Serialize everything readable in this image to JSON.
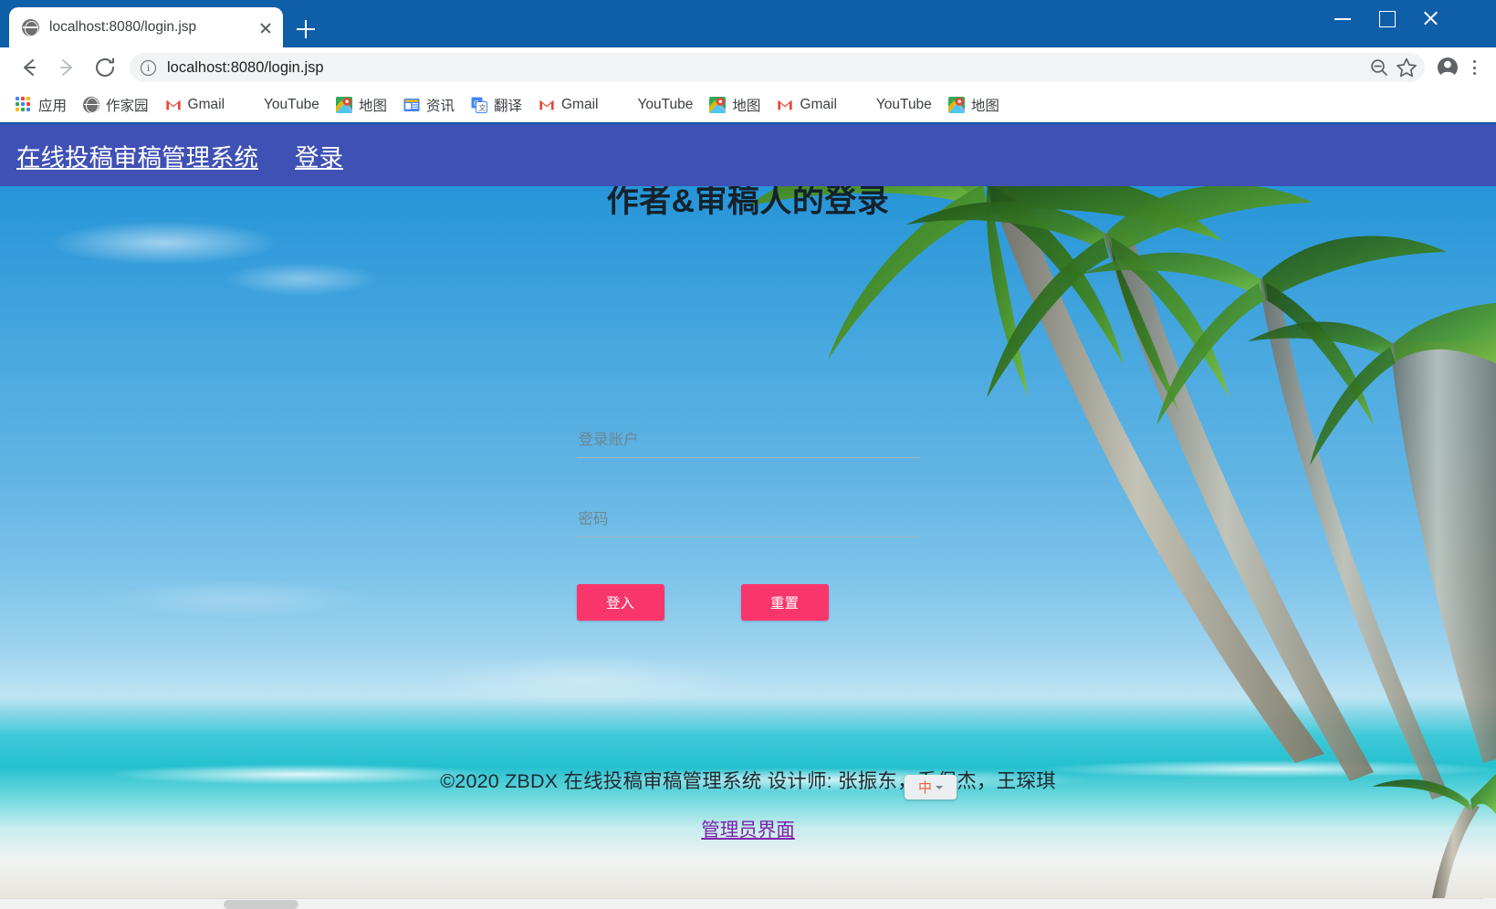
{
  "browser": {
    "tab": {
      "title": "localhost:8080/login.jsp",
      "favicon": "globe-icon",
      "close": "close-icon"
    },
    "newtab_label": "+",
    "window_controls": {
      "minimize": "minimize-icon",
      "maximize": "maximize-icon",
      "close": "close-icon"
    },
    "toolbar": {
      "back": "back-arrow-icon",
      "forward": "forward-arrow-icon",
      "reload": "reload-icon",
      "site_info": "i",
      "url": "localhost:8080/login.jsp",
      "zoom_out": "zoom-out-icon",
      "bookmark": "star-icon",
      "profile": "account-circle-icon",
      "menu": "three-dot-menu-icon"
    },
    "bookmarks": [
      {
        "label": "应用",
        "icon": "apps-grid-icon"
      },
      {
        "label": "作家园",
        "icon": "globe-icon"
      },
      {
        "label": "Gmail",
        "icon": "gmail-icon"
      },
      {
        "label": "YouTube",
        "icon": "youtube-icon"
      },
      {
        "label": "地图",
        "icon": "google-maps-icon"
      },
      {
        "label": "资讯",
        "icon": "google-news-icon"
      },
      {
        "label": "翻译",
        "icon": "google-translate-icon"
      },
      {
        "label": "Gmail",
        "icon": "gmail-icon"
      },
      {
        "label": "YouTube",
        "icon": "youtube-icon"
      },
      {
        "label": "地图",
        "icon": "google-maps-icon"
      },
      {
        "label": "Gmail",
        "icon": "gmail-icon"
      },
      {
        "label": "YouTube",
        "icon": "youtube-icon"
      },
      {
        "label": "地图",
        "icon": "google-maps-icon"
      }
    ]
  },
  "site": {
    "nav": {
      "brand": "在线投稿审稿管理系统",
      "login_link": "登录",
      "background_color": "#3f51b5"
    },
    "heading": "作者&审稿人的登录",
    "form": {
      "account": {
        "placeholder": "登录账户",
        "value": ""
      },
      "password": {
        "placeholder": "密码",
        "value": ""
      },
      "submit_label": "登入",
      "reset_label": "重置",
      "button_color": "#f8366b"
    },
    "footer": {
      "text": "©2020 ZBDX 在线投稿审稿管理系统 设计师: 张振东，乔保杰，王琛琪",
      "admin_link": "管理员界面",
      "admin_link_color": "#7b22a8"
    }
  },
  "overlay": {
    "ime_indicator": {
      "glyph": "中",
      "caret": "chevron-down-icon"
    }
  }
}
